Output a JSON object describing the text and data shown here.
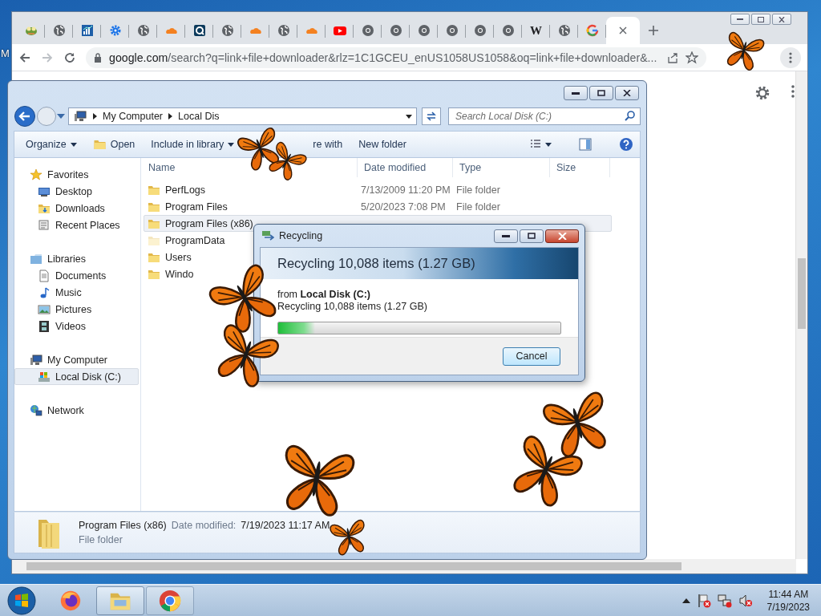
{
  "desktop": {
    "label": "M"
  },
  "browser": {
    "tabs": [
      {
        "kind": "frog",
        "selected": false
      },
      {
        "kind": "globe",
        "selected": false
      },
      {
        "kind": "chart",
        "selected": false
      },
      {
        "kind": "gear",
        "selected": false
      },
      {
        "kind": "globe",
        "selected": false
      },
      {
        "kind": "cloud",
        "selected": false
      },
      {
        "kind": "camera",
        "selected": false
      },
      {
        "kind": "globe",
        "selected": false
      },
      {
        "kind": "cloud",
        "selected": false
      },
      {
        "kind": "globe",
        "selected": false
      },
      {
        "kind": "cloud",
        "selected": false
      },
      {
        "kind": "video",
        "selected": false
      },
      {
        "kind": "ring",
        "selected": false
      },
      {
        "kind": "ring",
        "selected": false
      },
      {
        "kind": "ring",
        "selected": false
      },
      {
        "kind": "ring",
        "selected": false
      },
      {
        "kind": "ring",
        "selected": false
      },
      {
        "kind": "ring",
        "selected": false
      },
      {
        "kind": "letter",
        "label": "W",
        "selected": false
      },
      {
        "kind": "globe",
        "selected": false
      },
      {
        "kind": "quad",
        "selected": false
      },
      {
        "kind": "blank",
        "selected": true
      }
    ],
    "address": {
      "host": "google.com",
      "path": "/search?q=link+file+downloader&rlz=1C1GCEU_enUS1058US1058&oq=link+file+downloader&..."
    }
  },
  "explorer": {
    "breadcrumb": [
      "My Computer",
      "Local Dis"
    ],
    "search": {
      "placeholder": "Search Local Disk (C:)"
    },
    "toolbar": [
      {
        "label": "Organize",
        "kind": "menu"
      },
      {
        "label": "Open",
        "kind": "folder"
      },
      {
        "label": "Include in library",
        "kind": "menu"
      },
      {
        "label": "re with",
        "kind": "plain"
      },
      {
        "label": "New folder",
        "kind": "plain"
      }
    ],
    "nav": [
      {
        "label": "Favorites",
        "kind": "star",
        "selected": false,
        "children": [
          {
            "label": "Desktop",
            "kind": "desktop",
            "selected": false
          },
          {
            "label": "Downloads",
            "kind": "downloads",
            "selected": false
          },
          {
            "label": "Recent Places",
            "kind": "recent",
            "selected": false
          }
        ]
      },
      {
        "label": "Libraries",
        "kind": "library",
        "selected": false,
        "children": [
          {
            "label": "Documents",
            "kind": "document",
            "selected": false
          },
          {
            "label": "Music",
            "kind": "music",
            "selected": false
          },
          {
            "label": "Pictures",
            "kind": "pictures",
            "selected": false
          },
          {
            "label": "Videos",
            "kind": "videos",
            "selected": false
          }
        ]
      },
      {
        "label": "My Computer",
        "kind": "computer",
        "selected": false,
        "children": [
          {
            "label": "Local Disk (C:)",
            "kind": "disk",
            "selected": true
          }
        ]
      },
      {
        "label": "Network",
        "kind": "network",
        "selected": false
      }
    ],
    "columns": [
      "Name",
      "Date modified",
      "Type",
      "Size"
    ],
    "rows": [
      {
        "name": "PerfLogs",
        "date": "7/13/2009 11:20 PM",
        "type": "File folder",
        "selected": false,
        "hidden": false
      },
      {
        "name": "Program Files",
        "date": "5/20/2023 7:08 PM",
        "type": "File folder",
        "selected": false,
        "hidden": false
      },
      {
        "name": "Program Files (x86)",
        "selected": true,
        "hidden": false
      },
      {
        "name": "ProgramData",
        "selected": false,
        "hidden": true
      },
      {
        "name": "Users",
        "selected": false,
        "hidden": false
      },
      {
        "name": "Windo",
        "selected": false,
        "hidden": false
      }
    ],
    "details": {
      "name": "Program Files (x86)",
      "date_label": "Date modified:",
      "date": "7/19/2023 11:17 AM",
      "type": "File folder"
    }
  },
  "dialog": {
    "title": "Recycling",
    "header": "Recycling 10,088 items (1.27 GB)",
    "from": "from **Local Disk (C:)**",
    "status": "Recycling 10,088 items (1.27 GB)",
    "progress": {
      "level": 0.13
    },
    "button": "Cancel"
  },
  "taskbar": {
    "apps": [
      {
        "kind": "firefox",
        "selected": false
      },
      {
        "kind": "explorer",
        "selected": true
      },
      {
        "kind": "browser",
        "selected": false
      }
    ],
    "time": "11:44 AM",
    "date": "7/19/2023"
  }
}
